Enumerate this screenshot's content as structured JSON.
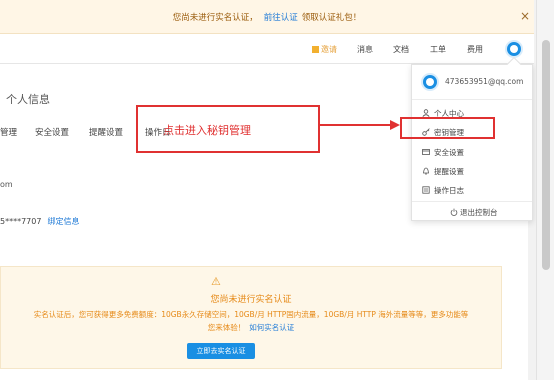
{
  "notice": {
    "message": "您尚未进行实名认证，",
    "link": "前往认证",
    "gift": "领取认证礼包！",
    "close": "×"
  },
  "header": {
    "invite": "邀请",
    "messages": "消息",
    "docs": "文档",
    "ticket": "工单",
    "fees": "费用"
  },
  "page": {
    "title": "个人信息",
    "tabs": [
      "管理",
      "安全设置",
      "提醒设置",
      "操作日"
    ],
    "email_fragment": "om",
    "phone": "5****7707",
    "bind_link": "绑定信息"
  },
  "verify": {
    "warning_icon": "warning-triangle-icon",
    "warning_glyph": "⚠",
    "title": "您尚未进行实名认证",
    "text": "实名认证后，您可获得更多免费额度：10GB永久存储空间，10GB/月 HTTP国内流量，10GB/月 HTTP 海外流量等等，更多功能等您来体验！",
    "link": "如何实名认证",
    "button": "立即去实名认证"
  },
  "dropdown": {
    "email": "473653951@qq.com",
    "items": [
      {
        "icon": "user-icon",
        "glyph": "👤",
        "label": "个人中心"
      },
      {
        "icon": "key-icon",
        "glyph": "⚷",
        "label": "密钥管理"
      },
      {
        "icon": "card-icon",
        "glyph": "▭",
        "label": "安全设置"
      },
      {
        "icon": "bell-icon",
        "glyph": "♪",
        "label": "提醒设置"
      },
      {
        "icon": "log-icon",
        "glyph": "▤",
        "label": "操作日志"
      }
    ],
    "logout": {
      "icon": "power-icon",
      "glyph": "⏻",
      "label": "退出控制台"
    }
  },
  "annotation": {
    "text": "点击进入秘钥管理",
    "color": "#e03131"
  },
  "colors": {
    "primary": "#1a8fe3",
    "warning": "#e68a18",
    "link": "#1f7ad6"
  }
}
